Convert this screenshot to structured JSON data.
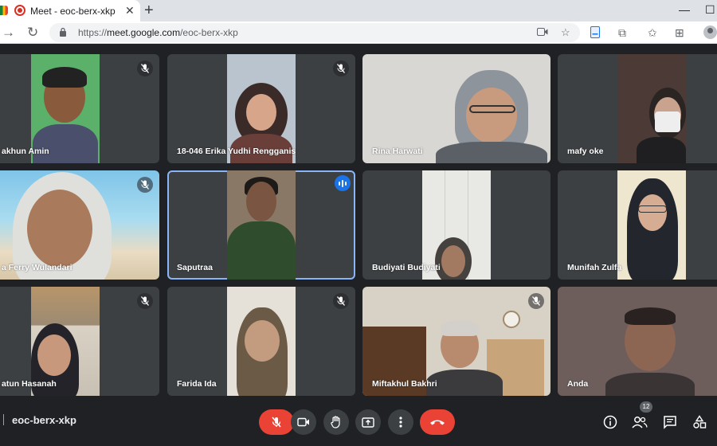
{
  "browser": {
    "tab_title": "Meet - eoc-berx-xkp",
    "tab_close": "✕",
    "new_tab": "+",
    "url_prefix": "https://",
    "url_host": "meet.google.com",
    "url_path": "/eoc-berx-xkp",
    "window_minimize": "—",
    "window_maximize": "☐"
  },
  "participants": [
    {
      "name": "akhun Amin",
      "muted": true
    },
    {
      "name": "18-046 Erika Yudhi Rengganis",
      "muted": true
    },
    {
      "name": "Rina Harwati",
      "muted": false
    },
    {
      "name": "mafy oke",
      "muted": false
    },
    {
      "name": "a Ferry Wulandari",
      "muted": true
    },
    {
      "name": "Saputraa",
      "muted": false,
      "speaking": true
    },
    {
      "name": "Budiyati Budiyati",
      "muted": false
    },
    {
      "name": "Munifah Zulfa",
      "muted": false
    },
    {
      "name": "atun Hasanah",
      "muted": true
    },
    {
      "name": "Farida Ida",
      "muted": true
    },
    {
      "name": "Miftakhul Bakhri",
      "muted": true
    },
    {
      "name": "Anda",
      "muted": false
    }
  ],
  "bottom": {
    "meeting_code": "eoc-berx-xkp",
    "participant_count": "12"
  },
  "colors": {
    "background": "#202124",
    "tile": "#3c4043",
    "active_border": "#8ab4f8",
    "end_call": "#ea4335",
    "speaking": "#1a73e8"
  },
  "icons": [
    "mic-off-icon",
    "camera-icon",
    "raise-hand-icon",
    "present-icon",
    "more-options-icon",
    "end-call-icon",
    "info-icon",
    "people-icon",
    "chat-icon",
    "activities-icon"
  ]
}
